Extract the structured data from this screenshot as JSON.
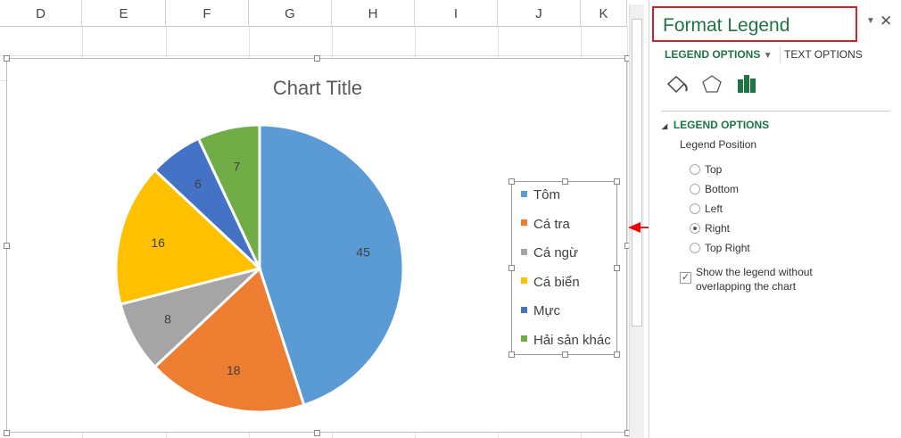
{
  "columns": [
    "D",
    "E",
    "F",
    "G",
    "H",
    "I",
    "J",
    "K"
  ],
  "chart": {
    "title": "Chart Title"
  },
  "chart_data": {
    "type": "pie",
    "title": "Chart Title",
    "categories": [
      "Tôm",
      "Cá tra",
      "Cá ngừ",
      "Cá biển",
      "Mực",
      "Hải sản khác"
    ],
    "values": [
      45,
      18,
      8,
      16,
      6,
      7
    ],
    "colors": [
      "#5b9bd5",
      "#ed7d31",
      "#a5a5a5",
      "#ffc000",
      "#4472c4",
      "#70ad47"
    ],
    "legend_position": "right"
  },
  "panel": {
    "title": "Format Legend",
    "tab_legend": "LEGEND OPTIONS",
    "tab_text": "TEXT OPTIONS",
    "section": "LEGEND OPTIONS",
    "position_label": "Legend Position",
    "options": [
      "Top",
      "Bottom",
      "Left",
      "Right",
      "Top Right"
    ],
    "selected": "Right",
    "overlap_label_1": "Show the legend without",
    "overlap_label_2": "overlapping the chart",
    "overlap_checked": true
  }
}
